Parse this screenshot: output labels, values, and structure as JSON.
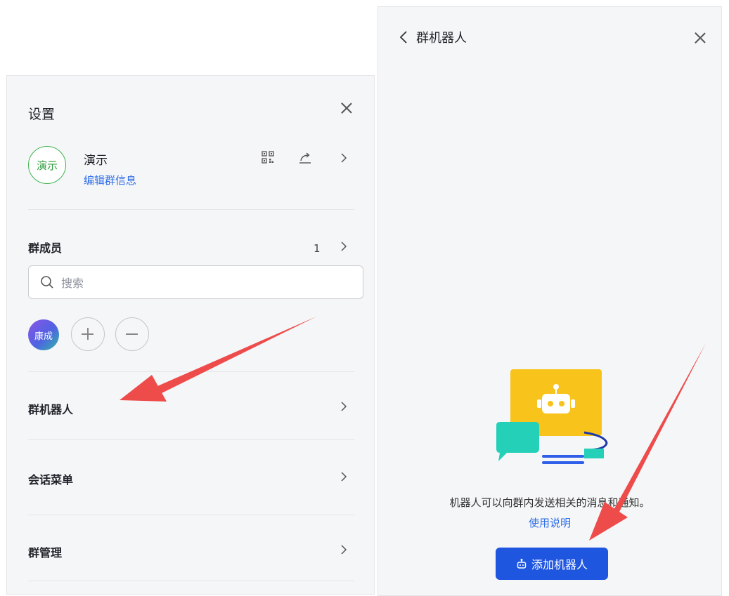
{
  "settings": {
    "title": "设置",
    "group": {
      "avatar_text": "演示",
      "name": "演示",
      "edit_link": "编辑群信息"
    },
    "members": {
      "label": "群成员",
      "count": "1",
      "search_placeholder": "搜索",
      "list": [
        {
          "avatar_text": "康成"
        }
      ]
    },
    "rows": [
      {
        "label": "群机器人"
      },
      {
        "label": "会话菜单"
      },
      {
        "label": "群管理"
      }
    ]
  },
  "robot_panel": {
    "title": "群机器人",
    "description": "机器人可以向群内发送相关的消息和通知。",
    "help_link": "使用说明",
    "add_button": "添加机器人"
  },
  "colors": {
    "accent": "#1f56e0",
    "link": "#2f6ee8",
    "group_avatar_green": "#3fb34f",
    "illustration_yellow": "#f8c31a",
    "illustration_teal": "#25d0b8",
    "annotation_arrow": "#ee4b4b"
  },
  "icons": [
    "close-icon",
    "qr-code-icon",
    "share-icon",
    "chevron-right-icon",
    "search-icon",
    "plus-icon",
    "minus-icon",
    "back-chevron-icon",
    "robot-icon"
  ]
}
